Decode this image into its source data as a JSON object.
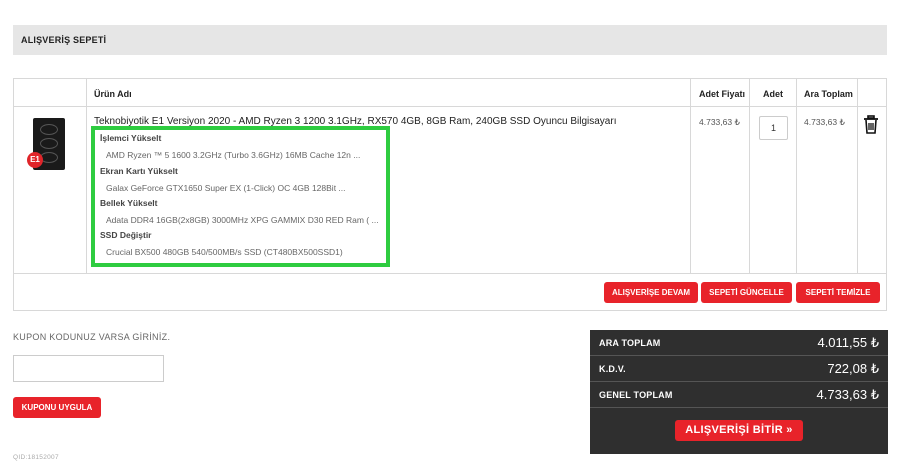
{
  "header": {
    "title": "ALIŞVERİŞ SEPETİ"
  },
  "table": {
    "columns": {
      "product_name": "Ürün Adı",
      "unit_price": "Adet Fiyatı",
      "quantity": "Adet",
      "subtotal": "Ara Toplam"
    },
    "rows": [
      {
        "name": "Teknobiyotik E1 Versiyon 2020 - AMD Ryzen 3 1200 3.1GHz, RX570 4GB, 8GB Ram, 240GB SSD Oyuncu Bilgisayarı",
        "badge": "E1",
        "options": [
          {
            "label": "İşlemci Yükselt",
            "value": "AMD Ryzen ™ 5 1600 3.2GHz (Turbo 3.6GHz) 16MB Cache 12n ..."
          },
          {
            "label": "Ekran Kartı Yükselt",
            "value": "Galax GeForce GTX1650 Super EX (1-Click) OC 4GB 128Bit ..."
          },
          {
            "label": "Bellek Yükselt",
            "value": "Adata DDR4 16GB(2x8GB) 3000MHz XPG GAMMIX D30 RED Ram ( ..."
          },
          {
            "label": "SSD Değiştir",
            "value": "Crucial BX500 480GB 540/500MB/s SSD (CT480BX500SSD1)"
          }
        ],
        "unit_price": "4.733,63 ₺",
        "quantity": "1",
        "line_total": "4.733,63 ₺",
        "delete_icon": "trash-icon"
      }
    ],
    "highlight_color": "#2ecc40"
  },
  "actions": {
    "continue_shopping": "ALIŞVERİŞE DEVAM",
    "update_cart": "SEPETİ GÜNCELLE",
    "clear_cart": "SEPETİ TEMİZLE"
  },
  "coupon": {
    "label": "KUPON KODUNUZ VARSA GİRİNİZ.",
    "input_value": "",
    "apply_button": "KUPONU UYGULA"
  },
  "qid": "QID:18152007",
  "totals": {
    "subtotal_label": "ARA TOPLAM",
    "subtotal_value": "4.011,55 ₺",
    "vat_label": "K.D.V.",
    "vat_value": "722,08 ₺",
    "grand_total_label": "GENEL TOPLAM",
    "grand_total_value": "4.733,63 ₺",
    "finish_button": "ALIŞVERİŞİ BİTİR »"
  },
  "colors": {
    "accent_red": "#e8232a",
    "totals_bg": "#2f2f2f",
    "header_bg": "#e6e6e6"
  }
}
